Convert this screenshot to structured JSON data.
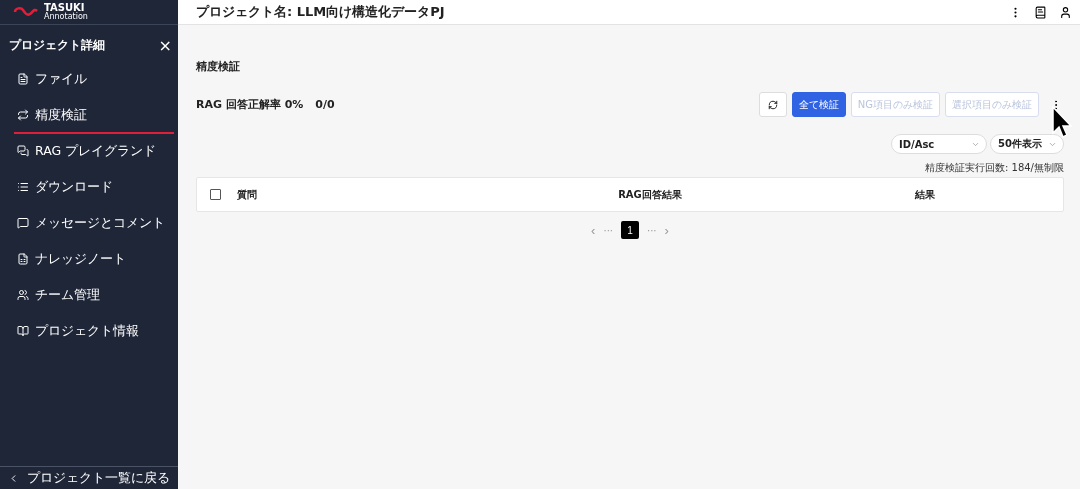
{
  "logo": {
    "name": "TASUKI",
    "sub": "Annotation"
  },
  "header": {
    "title": "プロジェクト名: LLM向け構造化データPJ"
  },
  "sidebar": {
    "title": "プロジェクト詳細",
    "close": "×",
    "items": [
      {
        "label": "ファイル",
        "selected": false
      },
      {
        "label": "精度検証",
        "selected": true
      },
      {
        "label": "RAG プレイグランド",
        "selected": false
      },
      {
        "label": "ダウンロード",
        "selected": false
      },
      {
        "label": "メッセージとコメント",
        "selected": false
      },
      {
        "label": "ナレッジノート",
        "selected": false
      },
      {
        "label": "チーム管理",
        "selected": false
      },
      {
        "label": "プロジェクト情報",
        "selected": false
      }
    ],
    "back": "プロジェクト一覧に戻る"
  },
  "page": {
    "title": "精度検証",
    "rate": "RAG 回答正解率 0%",
    "count": "0/0",
    "buttons": [
      {
        "label": "全て検証",
        "disabled": false
      },
      {
        "label": "NG項目のみ検証",
        "disabled": true
      },
      {
        "label": "選択項目のみ検証",
        "disabled": true
      }
    ],
    "sort": "ID/Asc",
    "per_page": "50件表示",
    "runs": "精度検証実行回数: 184/無制限",
    "table": {
      "select_all_checked": false,
      "columns": [
        "質問",
        "RAG回答結果",
        "結果"
      ]
    },
    "pagination": {
      "prev": "‹",
      "leading_ellipsis": "···",
      "pages": [
        {
          "label": "1",
          "selected": true
        }
      ],
      "trailing_ellipsis": "···",
      "next": "›"
    }
  }
}
